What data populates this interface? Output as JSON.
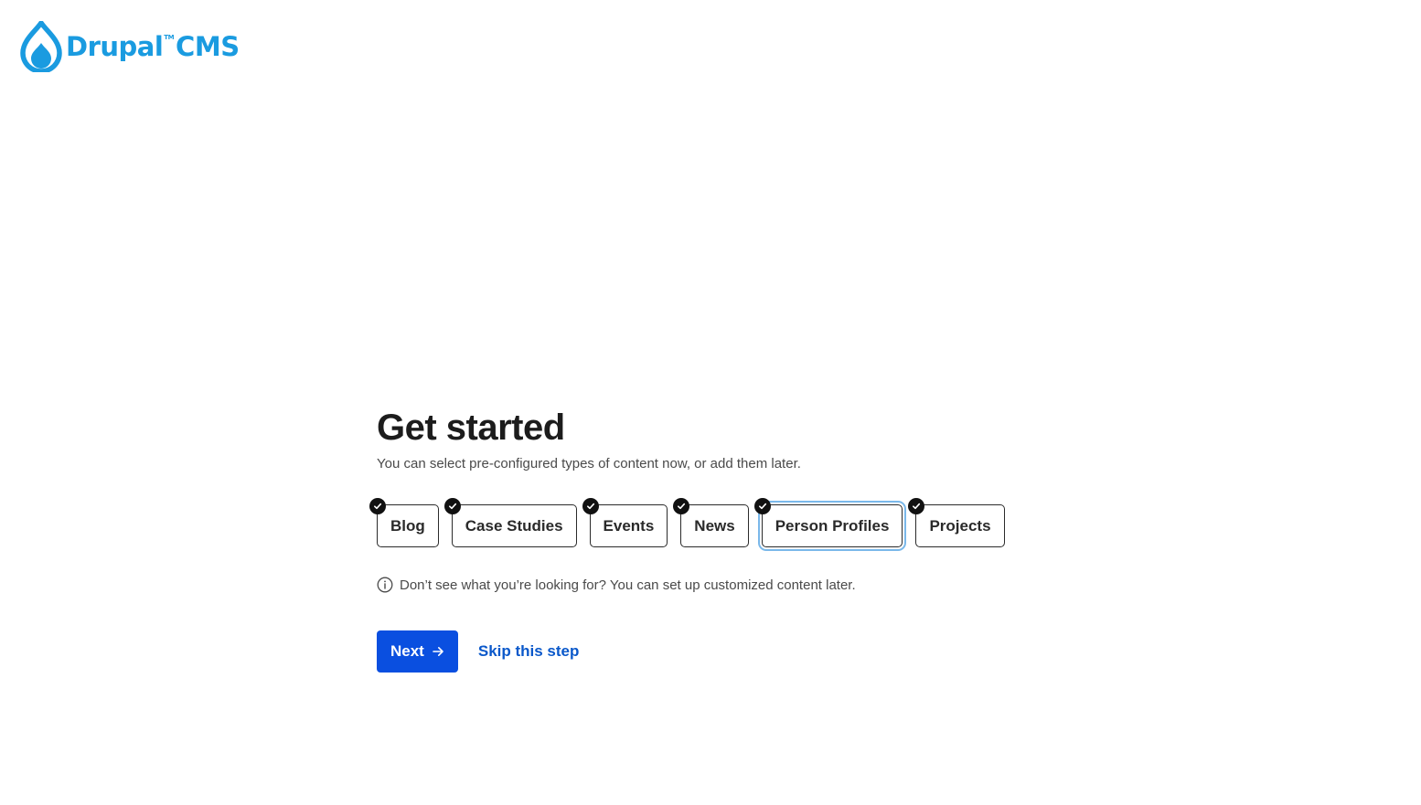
{
  "brand": {
    "name": "Drupal",
    "trademark": "TM",
    "product": "CMS",
    "color": "#1a9be0"
  },
  "main": {
    "title": "Get started",
    "subtitle": "You can select pre-configured types of content now, or add them later.",
    "options": [
      {
        "label": "Blog",
        "selected": true
      },
      {
        "label": "Case Studies",
        "selected": true
      },
      {
        "label": "Events",
        "selected": true
      },
      {
        "label": "News",
        "selected": true
      },
      {
        "label": "Person Profiles",
        "selected": true,
        "focused": true
      },
      {
        "label": "Projects",
        "selected": true
      }
    ],
    "hint": "Don’t see what you’re looking for? You can set up customized content later.",
    "hint_icon": "info-icon"
  },
  "actions": {
    "next_label": "Next",
    "next_icon": "arrow-right-icon",
    "skip_label": "Skip this step",
    "accent_color": "#0a4fe0"
  }
}
